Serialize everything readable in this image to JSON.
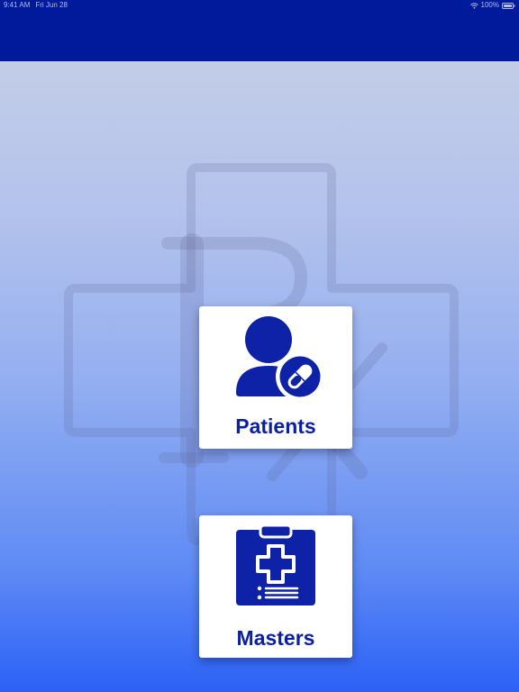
{
  "status_bar": {
    "time": "9:41 AM",
    "date": "Fri Jun 28",
    "battery_text": "100%",
    "icons": [
      "wifi-icon",
      "battery-icon"
    ]
  },
  "watermark": {
    "icon": "rx-cross-watermark",
    "letters": [
      "R",
      "x"
    ]
  },
  "menu": {
    "items": [
      {
        "label": "Patients",
        "icon": "patient-pill-icon"
      },
      {
        "label": "Masters",
        "icon": "clipboard-medical-icon"
      }
    ]
  },
  "colors": {
    "header": "#001a9c",
    "accent": "#0b1fa3",
    "card": "#ffffff",
    "gradient_top": "#c9d1e6",
    "gradient_bottom": "#2b61f6"
  }
}
